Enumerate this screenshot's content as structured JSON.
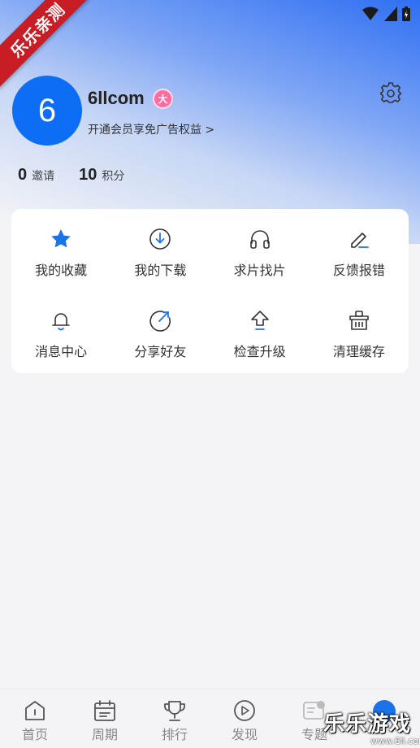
{
  "colors": {
    "accent": "#0d6ef5",
    "ribbon": "#c81d25",
    "vip_badge": "#ff6aa0",
    "icon_stroke": "#333333",
    "icon_accent": "#1a73e8"
  },
  "ribbon": {
    "text": "乐乐亲测"
  },
  "profile": {
    "avatar_letter": "6",
    "username": "6llcom",
    "vip_badge": "大",
    "vip_link": "开通会员享免广告权益 >"
  },
  "stats": [
    {
      "value": "0",
      "label": "邀请"
    },
    {
      "value": "10",
      "label": "积分"
    }
  ],
  "menu": [
    {
      "icon": "star-icon",
      "label": "我的收藏"
    },
    {
      "icon": "download-icon",
      "label": "我的下载"
    },
    {
      "icon": "headphones-icon",
      "label": "求片找片"
    },
    {
      "icon": "edit-icon",
      "label": "反馈报错"
    },
    {
      "icon": "bell-icon",
      "label": "消息中心"
    },
    {
      "icon": "share-icon",
      "label": "分享好友"
    },
    {
      "icon": "upgrade-icon",
      "label": "检查升级"
    },
    {
      "icon": "basket-icon",
      "label": "清理缓存"
    }
  ],
  "bottom_nav": [
    {
      "icon": "home-icon",
      "label": "首页"
    },
    {
      "icon": "calendar-icon",
      "label": "周期"
    },
    {
      "icon": "trophy-icon",
      "label": "排行"
    },
    {
      "icon": "play-icon",
      "label": "发现"
    },
    {
      "icon": "topic-icon",
      "label": "专题"
    }
  ],
  "watermark": {
    "text": "乐乐游戏",
    "url": "www.6ll.com"
  }
}
